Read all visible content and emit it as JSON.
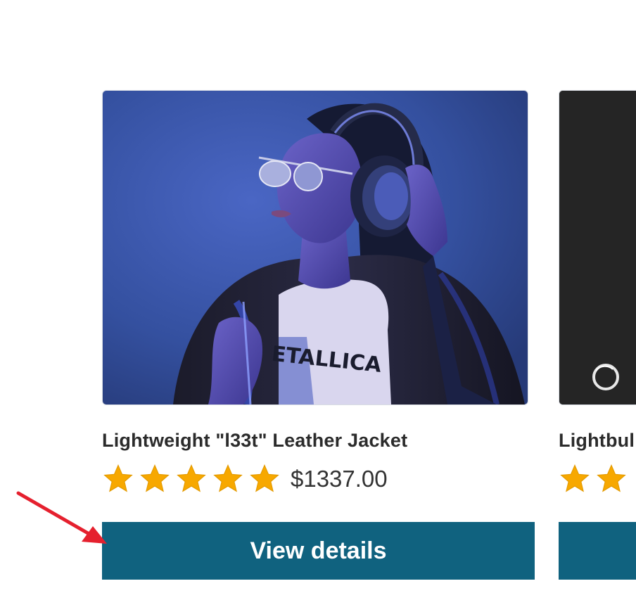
{
  "products": [
    {
      "title": "Lightweight \"l33t\" Leather Jacket",
      "rating": 5,
      "price": "$1337.00",
      "button_label": "View details",
      "image": "woman-with-headphones-photo"
    },
    {
      "title": "Lightbul",
      "rating": 2,
      "button_label": "",
      "image": "dark-chalkboard-photo"
    }
  ],
  "colors": {
    "button_bg": "#10627f",
    "star": "#f7a800",
    "arrow": "#e5202e"
  },
  "icons": {
    "star": "star-icon",
    "annotation": "red-arrow-icon"
  }
}
